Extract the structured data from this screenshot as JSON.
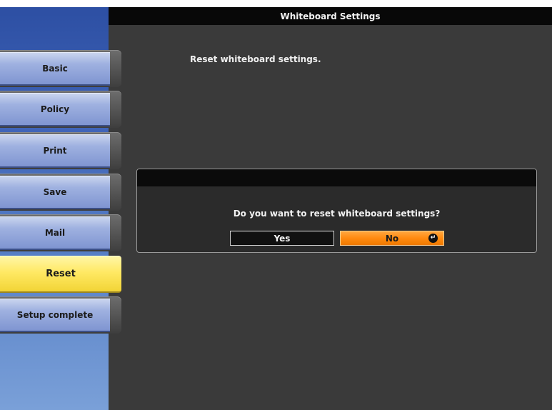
{
  "window": {
    "title": "Whiteboard Settings"
  },
  "sidebar": {
    "items": [
      {
        "label": "Basic"
      },
      {
        "label": "Policy"
      },
      {
        "label": "Print"
      },
      {
        "label": "Save"
      },
      {
        "label": "Mail"
      },
      {
        "label": "Reset",
        "active": true
      },
      {
        "label": "Setup complete"
      }
    ]
  },
  "main": {
    "message": "Reset whiteboard settings."
  },
  "dialog": {
    "question": "Do you want to reset whiteboard settings?",
    "yes_label": "Yes",
    "no_label": "No",
    "selected": "No",
    "enter_icon": "enter-icon"
  },
  "colors": {
    "accent_selected_button": "#ff8a10",
    "active_tab": "#ffe964",
    "tab": "#9fb1e0",
    "background": "#3a3a3a"
  }
}
